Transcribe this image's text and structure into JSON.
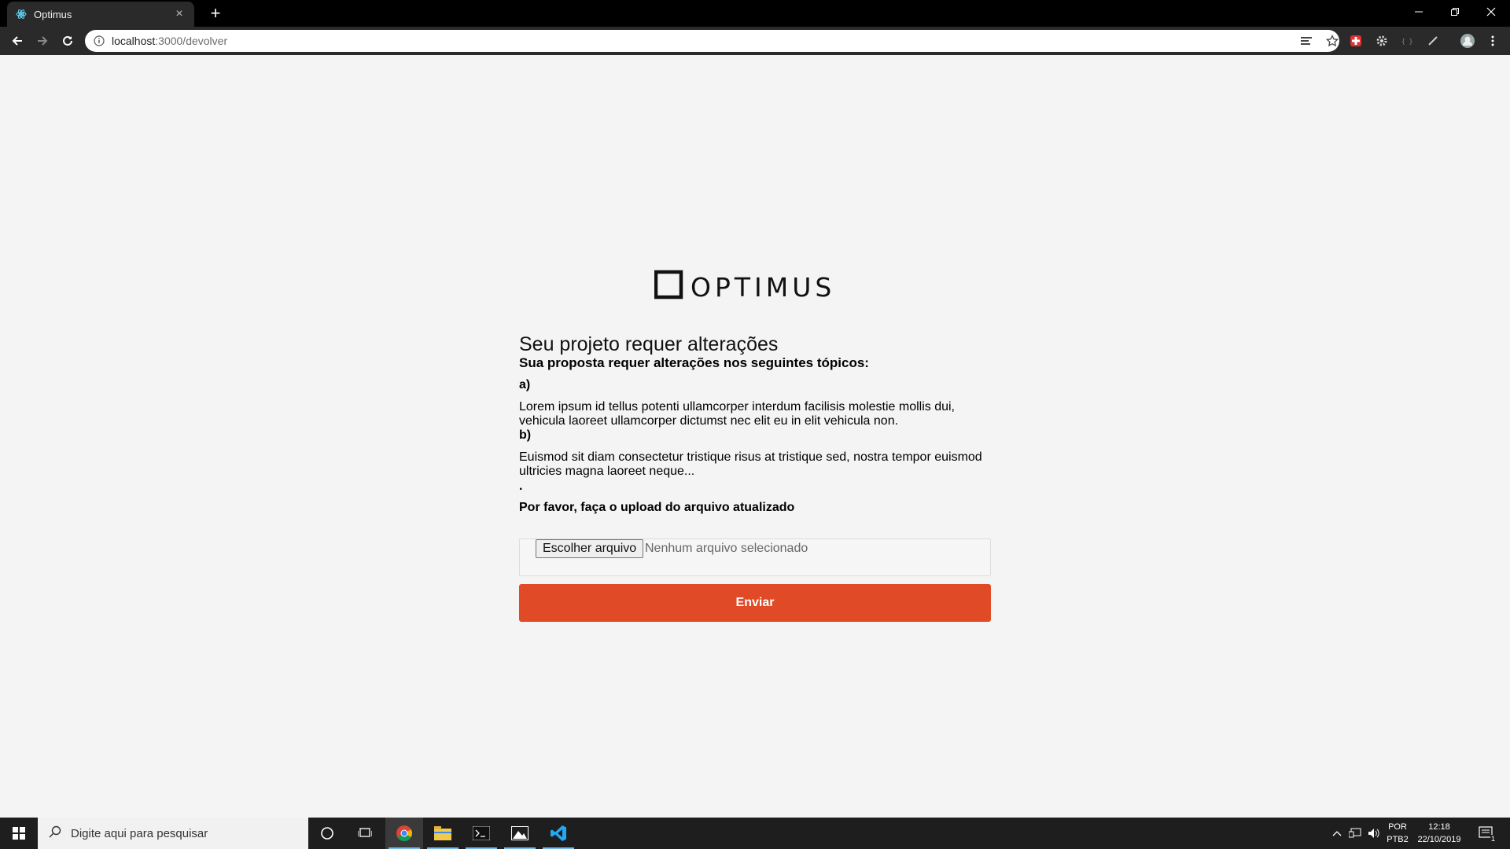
{
  "browser": {
    "tab_title": "Optimus",
    "tab_close": "×",
    "new_tab": "+",
    "url_host": "localhost",
    "url_path": ":3000/devolver"
  },
  "page": {
    "logo_text": "OPTIMUS",
    "title": "Seu projeto requer alterações",
    "subtitle": "Sua proposta requer alterações nos seguintes tópicos:",
    "items": [
      {
        "letter": "a)",
        "text": "Lorem ipsum id tellus potenti ullamcorper interdum facilisis molestie mollis dui, vehicula laoreet ullamcorper dictumst nec elit eu in elit vehicula non."
      },
      {
        "letter": "b)",
        "text": "Euismod sit diam consectetur tristique risus at tristique sed, nostra tempor euismod ultricies magna laoreet neque..."
      }
    ],
    "dot": ".",
    "upload_label": "Por favor, faça o upload do arquivo atualizado",
    "file_button": "Escolher arquivo",
    "file_status": "Nenhum arquivo selecionado",
    "submit_label": "Enviar",
    "accent_color": "#e04a26"
  },
  "taskbar": {
    "search_placeholder": "Digite aqui para pesquisar",
    "lang_line1": "POR",
    "lang_line2": "PTB2",
    "time": "12:18",
    "date": "22/10/2019",
    "notification_count": "1"
  }
}
